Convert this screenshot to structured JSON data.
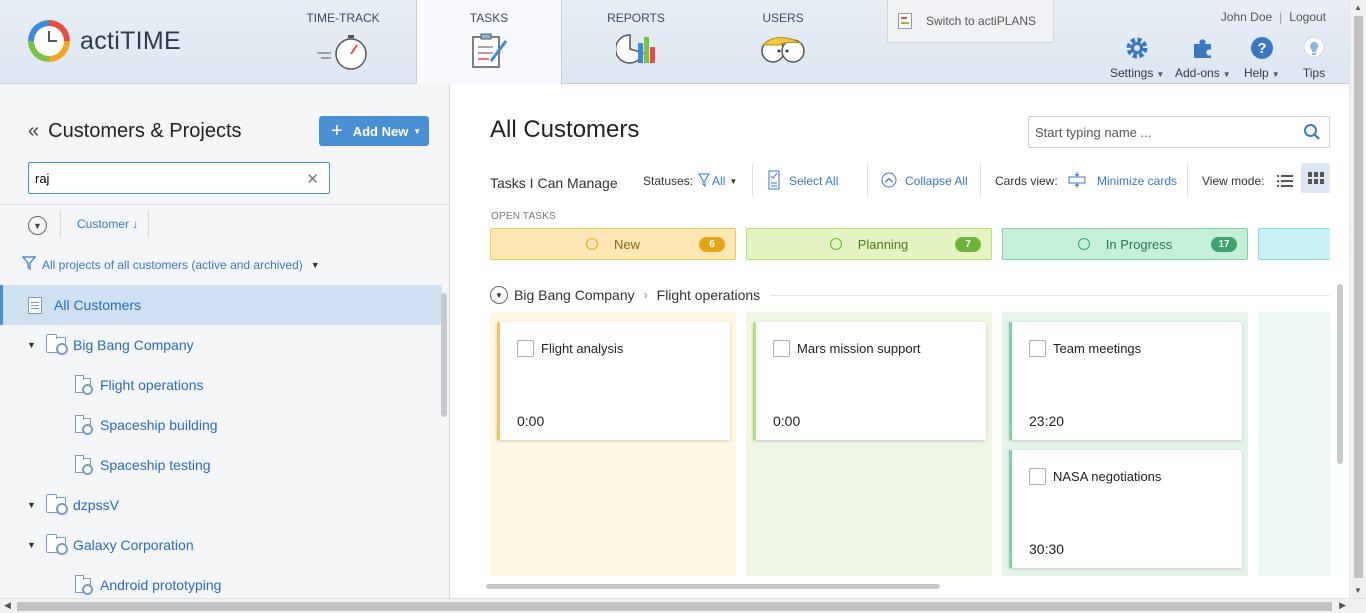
{
  "header": {
    "logo_text": "actiTIME",
    "nav": [
      {
        "label": "TIME-TRACK",
        "icon": "stopwatch-icon"
      },
      {
        "label": "TASKS",
        "icon": "clipboard-icon",
        "active": true
      },
      {
        "label": "REPORTS",
        "icon": "pie-bar-chart-icon"
      },
      {
        "label": "USERS",
        "icon": "users-icon"
      }
    ],
    "switch_label": "Switch to actiPLANS",
    "user_name": "John Doe",
    "logout": "Logout",
    "tools": {
      "settings": "Settings",
      "addons": "Add-ons",
      "help": "Help",
      "tips": "Tips"
    }
  },
  "left": {
    "title": "Customers & Projects",
    "add_new": "Add New",
    "search_value": "raj",
    "sort_label": "Customer",
    "filter_label": "All projects of all customers (active and archived)",
    "tree": [
      {
        "label": "All Customers",
        "type": "all",
        "selected": true
      },
      {
        "label": "Big Bang Company",
        "type": "customer"
      },
      {
        "label": "Flight operations",
        "type": "project"
      },
      {
        "label": "Spaceship building",
        "type": "project"
      },
      {
        "label": "Spaceship testing",
        "type": "project"
      },
      {
        "label": "dzpssV",
        "type": "customer"
      },
      {
        "label": "Galaxy Corporation",
        "type": "customer"
      },
      {
        "label": "Android prototyping",
        "type": "project"
      }
    ]
  },
  "main": {
    "title": "All Customers",
    "search_placeholder": "Start typing name ...",
    "toolbar": {
      "tasks_label": "Tasks I Can Manage",
      "statuses_label": "Statuses:",
      "statuses_value": "All",
      "select_all": "Select All",
      "collapse_all": "Collapse All",
      "cards_view_label": "Cards view:",
      "minimize_cards": "Minimize cards",
      "view_mode_label": "View mode:"
    },
    "open_tasks_label": "OPEN TASKS",
    "statuses": [
      {
        "label": "New",
        "count": "6",
        "bg": "#fde8b4",
        "border": "#f1c35a",
        "badge": "#e6a417",
        "text": "#8a6414"
      },
      {
        "label": "Planning",
        "count": "7",
        "bg": "#e3f4c2",
        "border": "#b7dc7a",
        "badge": "#6fb43a",
        "text": "#4f7a23"
      },
      {
        "label": "In Progress",
        "count": "17",
        "bg": "#c5efd9",
        "border": "#7dd3a7",
        "badge": "#3aa56e",
        "text": "#2d7451"
      },
      {
        "label": "",
        "count": "",
        "bg": "#c9f1f4",
        "border": "#85d8e1",
        "badge": "#3bb0be",
        "text": "#2c7a84"
      }
    ],
    "breadcrumb_customer": "Big Bang Company",
    "breadcrumb_project": "Flight operations",
    "cards": {
      "new": [
        {
          "name": "Flight analysis",
          "time": "0:00"
        }
      ],
      "planning": [
        {
          "name": "Mars mission support",
          "time": "0:00"
        }
      ],
      "in_progress": [
        {
          "name": "Team meetings",
          "time": "23:20"
        },
        {
          "name": "NASA negotiations",
          "time": "30:30"
        }
      ]
    }
  }
}
